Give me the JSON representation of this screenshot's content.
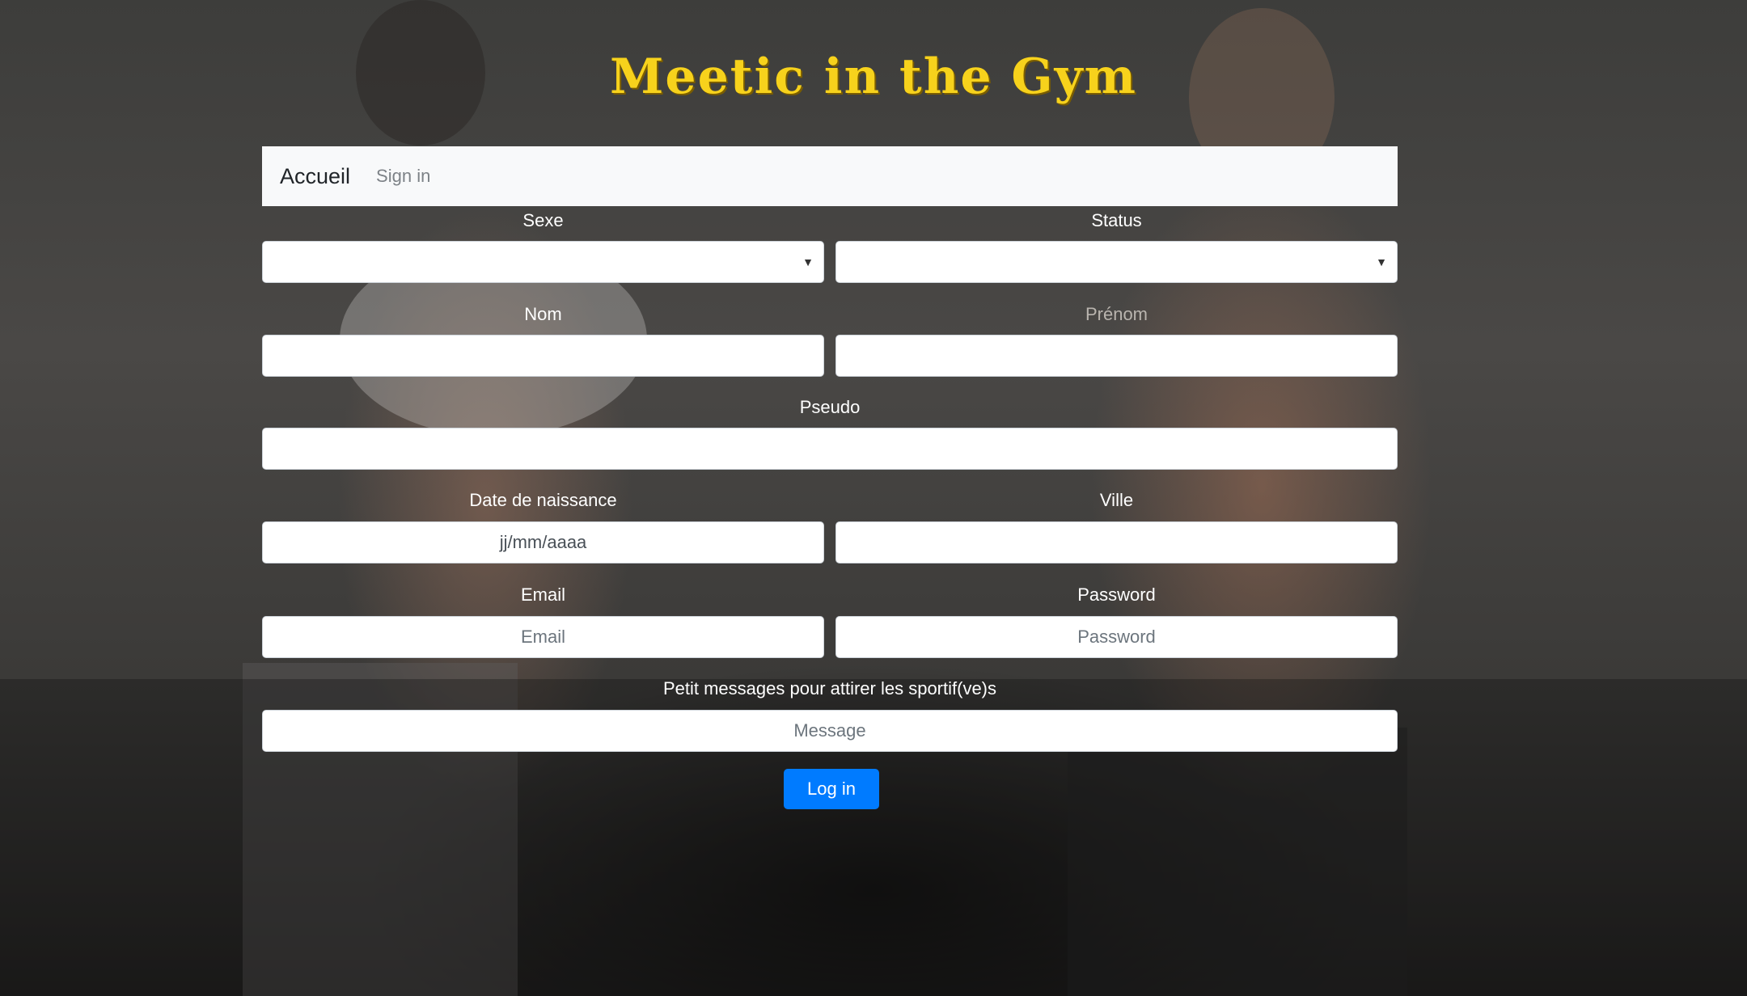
{
  "title": "Meetic in the Gym",
  "nav": {
    "brand": "Accueil",
    "signin": "Sign in"
  },
  "form": {
    "sexe_label": "Sexe",
    "status_label": "Status",
    "nom_label": "Nom",
    "prenom_label": "Prénom",
    "pseudo_label": "Pseudo",
    "date_label": "Date de naissance",
    "date_placeholder": "jj/mm/aaaa",
    "ville_label": "Ville",
    "email_label": "Email",
    "email_placeholder": "Email",
    "password_label": "Password",
    "password_placeholder": "Password",
    "message_label": "Petit messages pour attirer les sportif(ve)s",
    "message_placeholder": "Message",
    "submit_label": "Log in"
  },
  "icons": {
    "select_caret": "caret-down-icon"
  },
  "colors": {
    "title": "#f7d21c",
    "button": "#007bff",
    "navbar": "#f8f9fa"
  }
}
